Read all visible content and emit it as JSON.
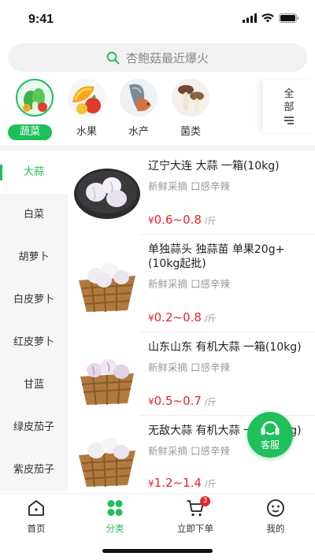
{
  "status_bar": {
    "time": "9:41"
  },
  "search": {
    "placeholder": "杏鲍菇最近爆火"
  },
  "categories": [
    {
      "label": "蔬菜",
      "icon": "vegetable-icon",
      "active": true
    },
    {
      "label": "水果",
      "icon": "fruit-icon",
      "active": false
    },
    {
      "label": "水产",
      "icon": "seafood-icon",
      "active": false
    },
    {
      "label": "菌类",
      "icon": "mushroom-icon",
      "active": false
    }
  ],
  "all_categories": {
    "label": "全部",
    "icon": "list-icon"
  },
  "sidebar": {
    "items": [
      "大蒜",
      "白菜",
      "胡萝卜",
      "白皮萝卜",
      "红皮萝卜",
      "甘蓝",
      "绿皮茄子",
      "紫皮茄子"
    ],
    "active_index": 0
  },
  "products": [
    {
      "name": "辽宁大连 大蒜 一箱(10kg)",
      "desc": "新鲜采摘 口感辛辣",
      "currency": "¥",
      "price": "0.6~0.8",
      "unit": "/斤",
      "image": "garlic-plate-icon"
    },
    {
      "name": "单独蒜头 独蒜苗 单果20g+(10kg起批)",
      "desc": "新鲜采摘 口感辛辣",
      "currency": "¥",
      "price": "0.2~0.8",
      "unit": "/斤",
      "image": "garlic-basket-icon"
    },
    {
      "name": "山东山东 有机大蒜 一箱(10kg)",
      "desc": "新鲜采摘 口感辛辣",
      "currency": "¥",
      "price": "0.5~0.7",
      "unit": "/斤",
      "image": "garlic-basket-icon"
    },
    {
      "name": "无敌大蒜 有机大蒜 一箱(10kg)",
      "desc": "新鲜采摘 口感辛辣",
      "currency": "¥",
      "price": "1.2~1.4",
      "unit": "/斤",
      "image": "garlic-basket-icon"
    }
  ],
  "service": {
    "label": "客服"
  },
  "tabs": [
    {
      "label": "首页",
      "icon": "home-icon",
      "active": false
    },
    {
      "label": "分类",
      "icon": "category-icon",
      "active": true
    },
    {
      "label": "立即下单",
      "icon": "cart-icon",
      "active": false,
      "badge": "3"
    },
    {
      "label": "我的",
      "icon": "profile-icon",
      "active": false
    }
  ],
  "colors": {
    "accent": "#1fbf5c",
    "price": "#e6242b"
  }
}
